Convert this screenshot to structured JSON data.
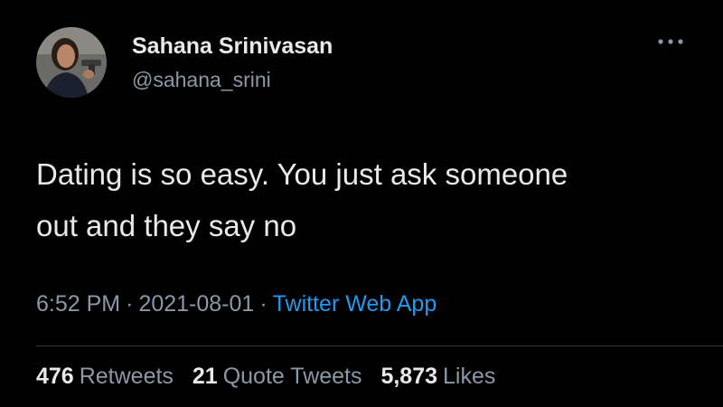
{
  "user": {
    "display_name": "Sahana Srinivasan",
    "handle": "@sahana_srini"
  },
  "tweet": {
    "text": "Dating is so easy. You just ask someone\nout and they say no",
    "time": "6:52 PM",
    "separator": "·",
    "date": "2021-08-01",
    "source": "Twitter Web App"
  },
  "stats": {
    "retweets_count": "476",
    "retweets_label": "Retweets",
    "quotes_count": "21",
    "quotes_label": "Quote Tweets",
    "likes_count": "5,873",
    "likes_label": "Likes"
  },
  "icons": {
    "more": "more-options-icon"
  },
  "colors": {
    "background": "#000000",
    "text_primary": "#e7e9ea",
    "text_secondary": "#8b98a5",
    "link": "#1d9bf0",
    "divider": "#2f3336"
  }
}
